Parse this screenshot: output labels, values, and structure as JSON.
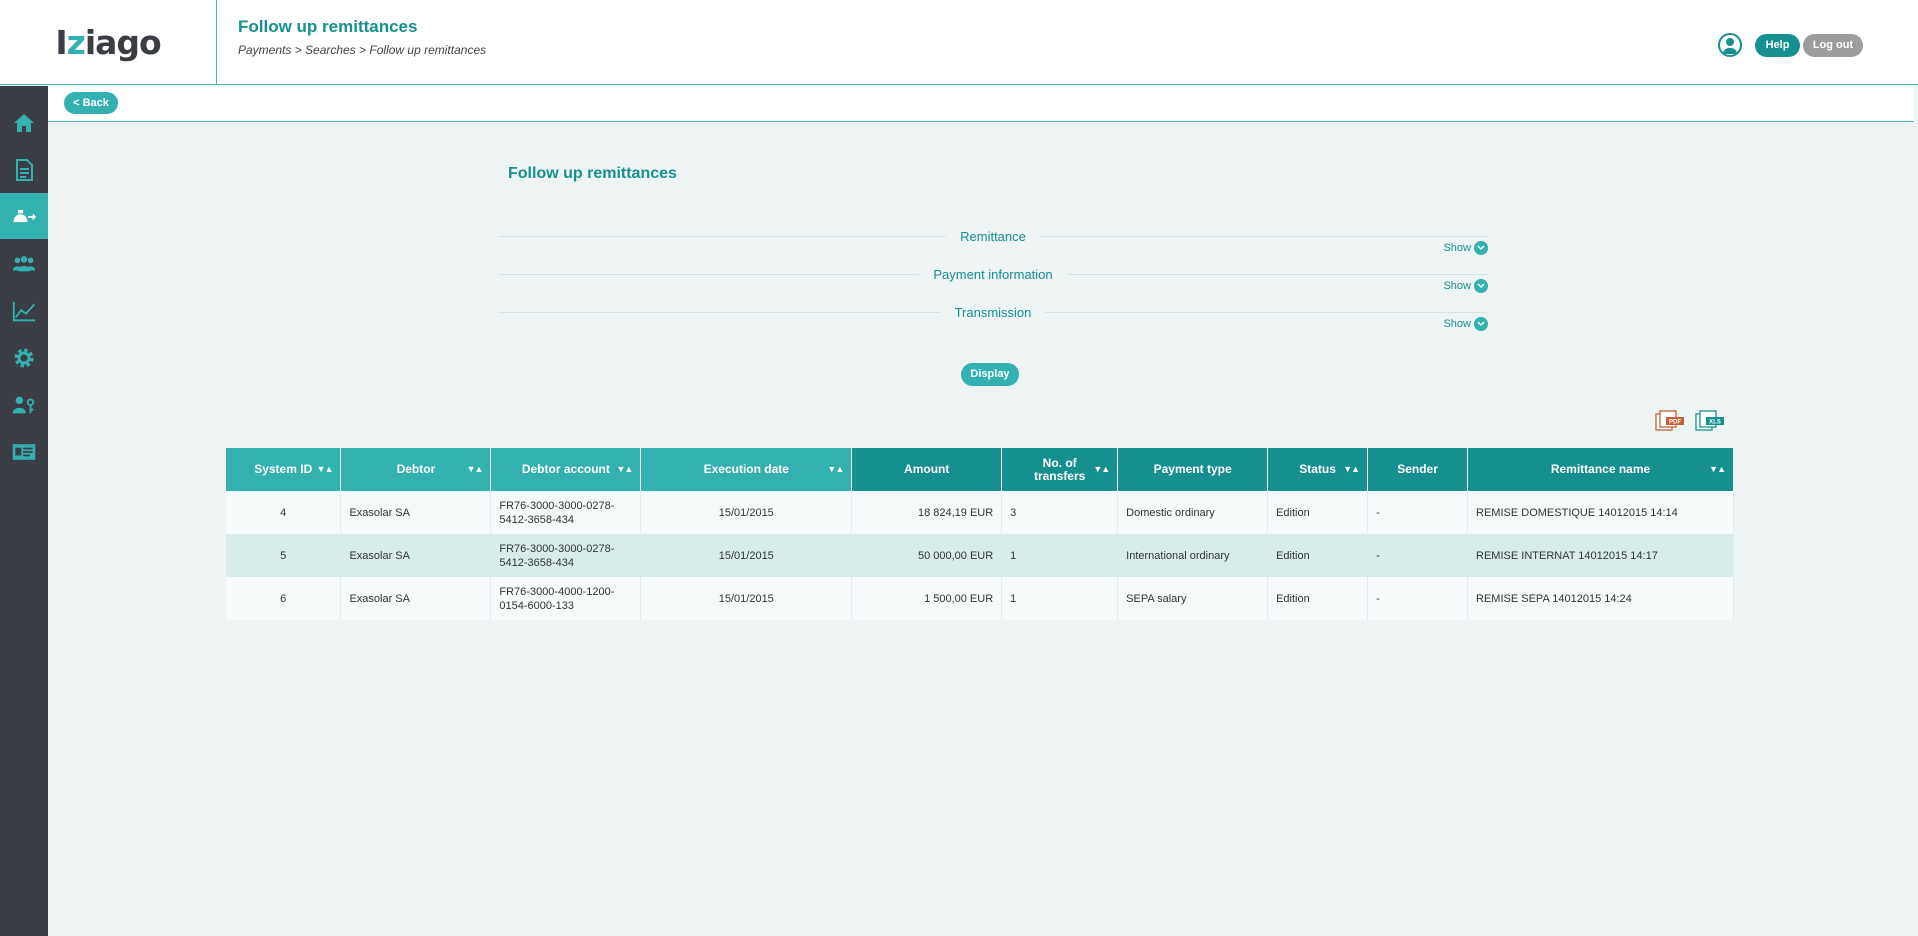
{
  "header": {
    "logo": {
      "pre": "I",
      "slash": "z",
      "post": "iago"
    },
    "title": "Follow up remittances",
    "breadcrumb": "Payments > Searches > Follow up remittances",
    "help_label": "Help",
    "logout_label": "Log out"
  },
  "sidebar": {
    "items": [
      {
        "icon": "home-icon",
        "active": false
      },
      {
        "icon": "document-icon",
        "active": false
      },
      {
        "icon": "payment-transfer-icon",
        "active": true
      },
      {
        "icon": "users-icon",
        "active": false
      },
      {
        "icon": "chart-line-icon",
        "active": false
      },
      {
        "icon": "gear-icon",
        "active": false
      },
      {
        "icon": "user-key-icon",
        "active": false
      },
      {
        "icon": "id-card-icon",
        "active": false
      }
    ]
  },
  "backbar": {
    "back_label": "< Back"
  },
  "main": {
    "title": "Follow up remittances",
    "sections": [
      {
        "label": "Remittance",
        "toggle": "Show"
      },
      {
        "label": "Payment information",
        "toggle": "Show"
      },
      {
        "label": "Transmission",
        "toggle": "Show"
      }
    ],
    "display_label": "Display",
    "exports": {
      "pdf": "PDF",
      "xls": "XLS"
    }
  },
  "table": {
    "headers": [
      "System ID",
      "Debtor",
      "Debtor account",
      "Execution date",
      "Amount",
      "No. of transfers",
      "Payment type",
      "Status",
      "Sender",
      "Remittance name"
    ],
    "rows": [
      [
        "4",
        "Exasolar SA",
        "FR76-3000-3000-0278-5412-3658-434",
        "15/01/2015",
        "18 824,19 EUR",
        "3",
        "Domestic ordinary",
        "Edition",
        "-",
        "REMISE DOMESTIQUE 14012015 14:14"
      ],
      [
        "5",
        "Exasolar SA",
        "FR76-3000-3000-0278-5412-3658-434",
        "15/01/2015",
        "50 000,00 EUR",
        "1",
        "International ordinary",
        "Edition",
        "-",
        "REMISE INTERNAT 14012015 14:17"
      ],
      [
        "6",
        "Exasolar SA",
        "FR76-3000-4000-1200-0154-6000-133",
        "15/01/2015",
        "1 500,00 EUR",
        "1",
        "SEPA salary",
        "Edition",
        "-",
        "REMISE SEPA 14012015 14:24"
      ]
    ]
  },
  "colors": {
    "accent": "#33b0b0",
    "accent_dark": "#168f90",
    "sidebar_bg": "#3b3d45",
    "page_bg": "#eef4f3"
  }
}
